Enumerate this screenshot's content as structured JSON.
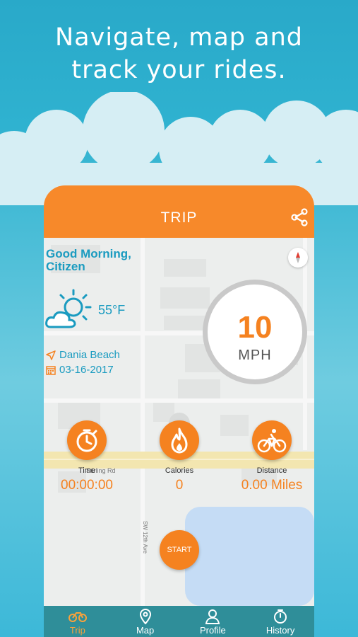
{
  "headline": {
    "line1": "Navigate, map and",
    "line2": "track your rides."
  },
  "screen": {
    "title": "TRIP",
    "greeting": {
      "line1": "Good Morning,",
      "line2": "Citizen"
    },
    "temperature": "55°F",
    "location": "Dania Beach",
    "date": "03-16-2017",
    "speed": {
      "value": "10",
      "unit": "MPH"
    },
    "map_labels": {
      "road_horizontal": "Stirling Rd",
      "road_vertical": "SW 12th Ave"
    },
    "stats": [
      {
        "label": "Time",
        "value": "00:00:00",
        "icon": "stopwatch-icon"
      },
      {
        "label": "Calories",
        "value": "0",
        "icon": "flame-icon"
      },
      {
        "label": "Distance",
        "value": "0.00 Miles",
        "icon": "bicycle-icon"
      }
    ],
    "start_label": "START"
  },
  "tabs": [
    {
      "label": "Trip",
      "icon": "bike-icon",
      "active": true
    },
    {
      "label": "Map",
      "icon": "map-pin-icon",
      "active": false
    },
    {
      "label": "Profile",
      "icon": "user-icon",
      "active": false
    },
    {
      "label": "History",
      "icon": "stopwatch-icon",
      "active": false
    }
  ],
  "colors": {
    "accent": "#f58220",
    "primary_blue": "#1a9bc0",
    "tabbar": "#2f8e99"
  }
}
